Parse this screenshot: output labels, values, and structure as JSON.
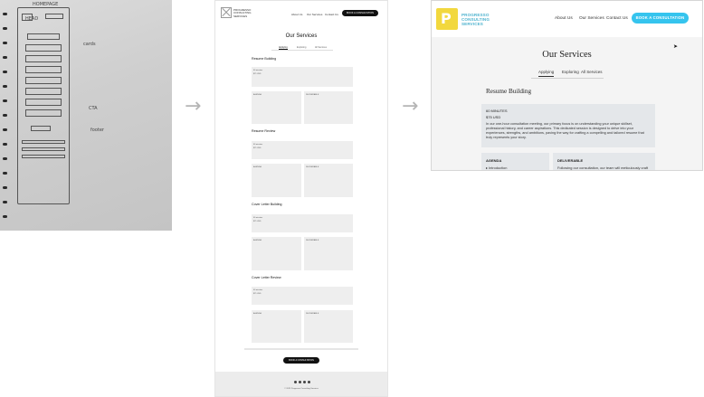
{
  "sketch": {
    "notes": {
      "title": "HOMEPAGE",
      "header": "HEAD",
      "cards": "cards",
      "cta": "CTA",
      "footer": "footer"
    }
  },
  "wireframe": {
    "brand": "PROGRESSO CONSULTING SERVICES",
    "nav": [
      "About Us",
      "Our Services",
      "Contact Us"
    ],
    "cta": "BOOK A CONSULTATION",
    "title": "Our Services",
    "tabs": [
      "Applying",
      "Exploring",
      "All Services"
    ],
    "sections": [
      {
        "heading": "Resume Building",
        "duration": "60 minutes",
        "price": "$75 USD",
        "agenda_label": "AGENDA",
        "deliverable_label": "DELIVERABLE"
      },
      {
        "heading": "Resume Review",
        "duration": "60 minutes",
        "price": "$75 USD",
        "agenda_label": "AGENDA",
        "deliverable_label": "DELIVERABLE"
      },
      {
        "heading": "Cover Letter Building",
        "duration": "60 minutes",
        "price": "$75 USD",
        "agenda_label": "AGENDA",
        "deliverable_label": "DELIVERABLE"
      },
      {
        "heading": "Cover Letter Review",
        "duration": "60 minutes",
        "price": "$75 USD",
        "agenda_label": "AGENDA",
        "deliverable_label": "DELIVERABLE"
      }
    ],
    "footer_copy": "© 2023 Progresso Consulting Services"
  },
  "hifi": {
    "brand_lines": [
      "PROGRESSO",
      "CONSULTING",
      "SERVICES"
    ],
    "logo_letter": "P",
    "nav": [
      "About Us",
      "Our Services",
      "Contact Us"
    ],
    "cta": "BOOK A CONSULTATION",
    "title": "Our Services",
    "tabs": [
      "Applying",
      "Exploring",
      "All Services"
    ],
    "active_tab": "Applying",
    "section_heading": "Resume Building",
    "duration": "60 MINUTES",
    "price": "$75 USD",
    "description": "In our one-hour consultation meeting, our primary focus is on understanding your unique skillset, professional history, and career aspirations. This dedicated session is designed to delve into your experiences, strengths, and ambitions, paving the way for crafting a compelling and tailored resume that truly represents your story.",
    "agenda_label": "AGENDA",
    "agenda_first": "Introduction",
    "deliverable_label": "DELIVERABLE",
    "deliverable_text": "Following our consultation, our team will meticulously craft",
    "colors": {
      "accent": "#35c4ee",
      "brand_text": "#4fb3cf",
      "logo_bg": "#f2d83e",
      "card_bg": "#e4e7ea"
    }
  },
  "icons": {
    "arrow": "→"
  }
}
